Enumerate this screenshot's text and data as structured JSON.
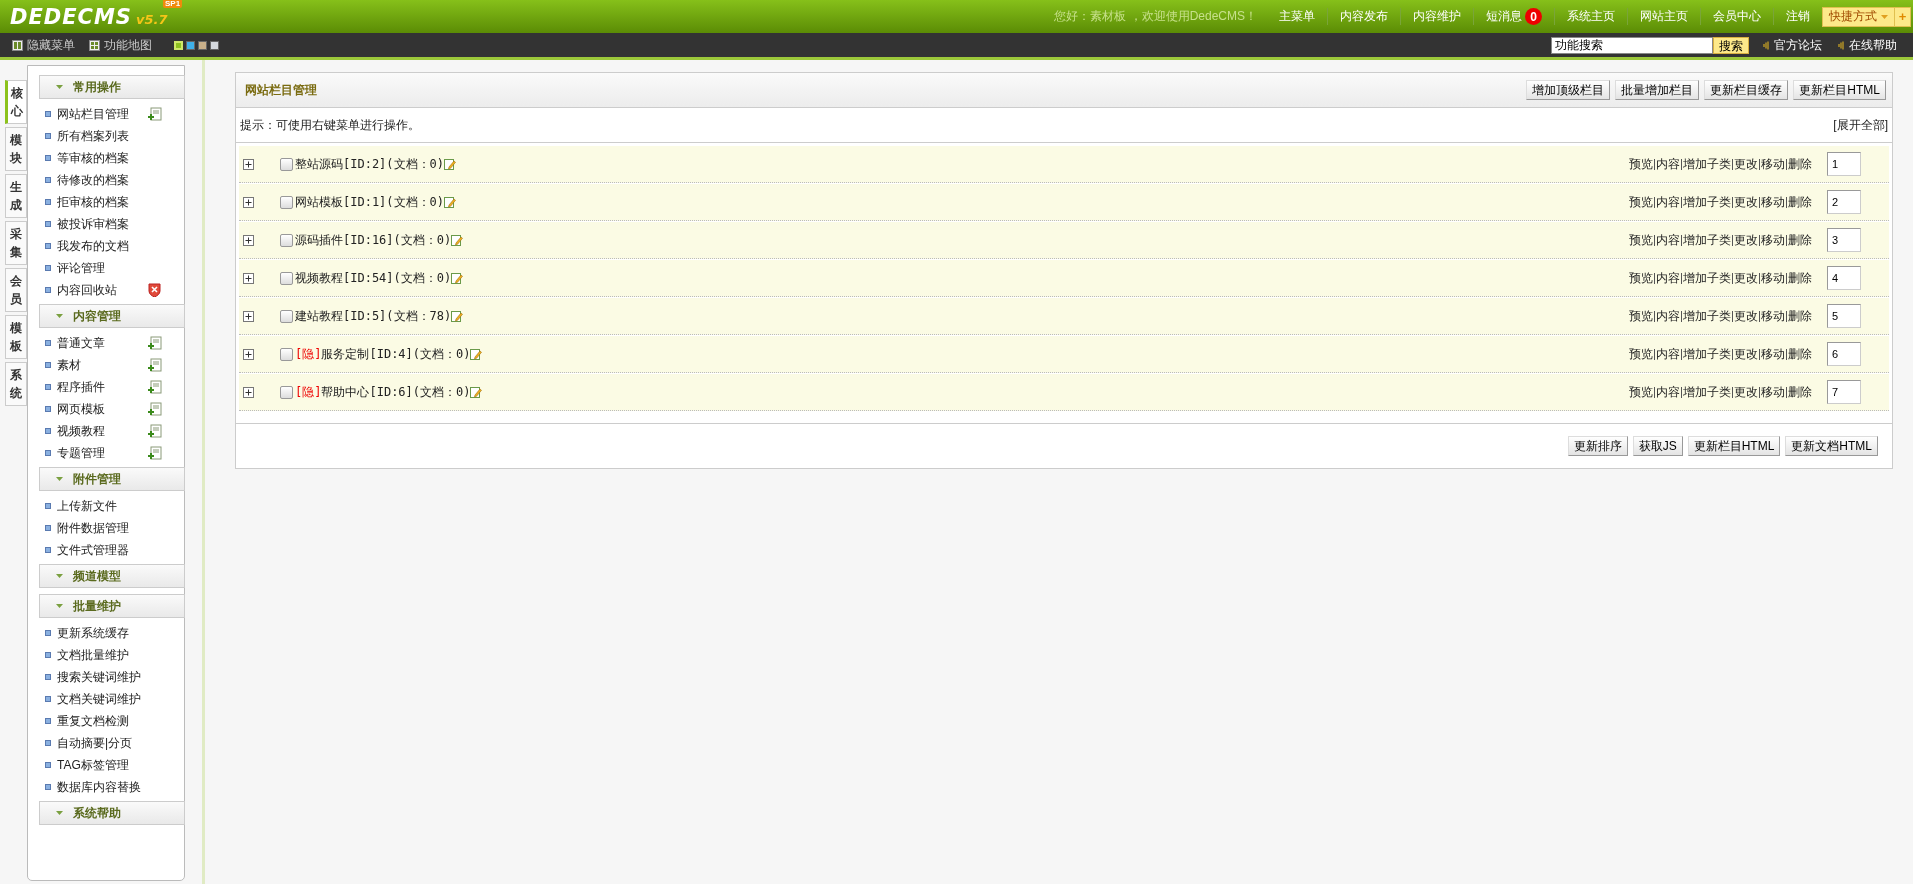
{
  "header": {
    "logo": "DEDECMS",
    "badge": "SP1",
    "version": "v5.7",
    "greeting": "您好：素材板 ，欢迎使用DedeCMS！",
    "nav": [
      {
        "label": "主菜单"
      },
      {
        "label": "内容发布"
      },
      {
        "label": "内容维护"
      },
      {
        "label": "短消息",
        "count": "0"
      },
      {
        "label": "系统主页"
      },
      {
        "label": "网站主页"
      },
      {
        "label": "会员中心"
      },
      {
        "label": "注销"
      }
    ],
    "shortcut": {
      "label": "快捷方式",
      "plus": "+"
    }
  },
  "toolbar": {
    "items": [
      {
        "label": "隐藏菜单",
        "kind": "hide"
      },
      {
        "label": "功能地图",
        "kind": "map"
      }
    ],
    "themes": [
      {
        "color": "#8dc21f",
        "selected": true
      },
      {
        "color": "#3fb0e8",
        "selected": false
      },
      {
        "color": "#c8b08a",
        "selected": false
      },
      {
        "color": "#d4d8dc",
        "selected": false
      }
    ],
    "search": {
      "value": "功能搜索",
      "button": "搜索"
    },
    "links": [
      "官方论坛",
      "在线帮助"
    ]
  },
  "side_tabs": [
    {
      "label": "核心",
      "selected": true
    },
    {
      "label": "模块",
      "selected": false
    },
    {
      "label": "生成",
      "selected": false
    },
    {
      "label": "采集",
      "selected": false
    },
    {
      "label": "会员",
      "selected": false
    },
    {
      "label": "模板",
      "selected": false
    },
    {
      "label": "系统",
      "selected": false
    }
  ],
  "menu": [
    {
      "title": "常用操作",
      "items": [
        {
          "label": "网站栏目管理",
          "kind": "add"
        },
        {
          "label": "所有档案列表"
        },
        {
          "label": "等审核的档案"
        },
        {
          "label": "待修改的档案"
        },
        {
          "label": "拒审核的档案"
        },
        {
          "label": "被投诉审档案"
        },
        {
          "label": "我发布的文档"
        },
        {
          "label": "评论管理"
        },
        {
          "label": "内容回收站",
          "kind": "clear"
        }
      ]
    },
    {
      "title": "内容管理",
      "items": [
        {
          "label": "普通文章",
          "kind": "add"
        },
        {
          "label": "素材",
          "kind": "add"
        },
        {
          "label": "程序插件",
          "kind": "add"
        },
        {
          "label": "网页模板",
          "kind": "add"
        },
        {
          "label": "视频教程",
          "kind": "add"
        },
        {
          "label": "专题管理",
          "kind": "add"
        }
      ]
    },
    {
      "title": "附件管理",
      "items": [
        {
          "label": "上传新文件"
        },
        {
          "label": "附件数据管理"
        },
        {
          "label": "文件式管理器"
        }
      ]
    },
    {
      "title": "频道模型"
    },
    {
      "title": "批量维护",
      "items": [
        {
          "label": "更新系统缓存"
        },
        {
          "label": "文档批量维护"
        },
        {
          "label": "搜索关键词维护"
        },
        {
          "label": "文档关键词维护"
        },
        {
          "label": "重复文档检测"
        },
        {
          "label": "自动摘要|分页"
        },
        {
          "label": "TAG标签管理"
        },
        {
          "label": "数据库内容替换"
        }
      ]
    },
    {
      "title": "系统帮助"
    }
  ],
  "panel": {
    "title": "网站栏目管理",
    "buttons": [
      "增加顶级栏目",
      "批量增加栏目",
      "更新栏目缓存",
      "更新栏目HTML"
    ],
    "hint": "提示：可使用右键菜单进行操作。",
    "expand_all": "[展开全部]",
    "categories": [
      {
        "name": "整站源码[ID:2](文档：0)",
        "checked": false,
        "actions": [
          "预览",
          "内容",
          "增加子类",
          "更改",
          "移动",
          "删除"
        ],
        "order": "1"
      },
      {
        "name": "网站模板[ID:1](文档：0)",
        "checked": false,
        "actions": [
          "预览",
          "内容",
          "增加子类",
          "更改",
          "移动",
          "删除"
        ],
        "order": "2"
      },
      {
        "name": "源码插件[ID:16](文档：0)",
        "checked": false,
        "actions": [
          "预览",
          "内容",
          "增加子类",
          "更改",
          "移动",
          "删除"
        ],
        "order": "3"
      },
      {
        "name": "视频教程[ID:54](文档：0)",
        "checked": false,
        "actions": [
          "预览",
          "内容",
          "增加子类",
          "更改",
          "移动",
          "删除"
        ],
        "order": "4"
      },
      {
        "name": "建站教程[ID:5](文档：78)",
        "checked": false,
        "actions": [
          "预览",
          "内容",
          "增加子类",
          "更改",
          "移动",
          "删除"
        ],
        "order": "5"
      },
      {
        "tag": "[隐]",
        "name": "服务定制[ID:4](文档：0)",
        "checked": false,
        "actions": [
          "预览",
          "内容",
          "增加子类",
          "更改",
          "移动",
          "删除"
        ],
        "order": "6"
      },
      {
        "tag": "[隐]",
        "name": "帮助中心[ID:6](文档：0)",
        "checked": false,
        "actions": [
          "预览",
          "内容",
          "增加子类",
          "更改",
          "移动",
          "删除"
        ],
        "order": "7"
      }
    ],
    "footer_buttons": [
      "更新排序",
      "获取JS",
      "更新栏目HTML",
      "更新文档HTML"
    ]
  }
}
